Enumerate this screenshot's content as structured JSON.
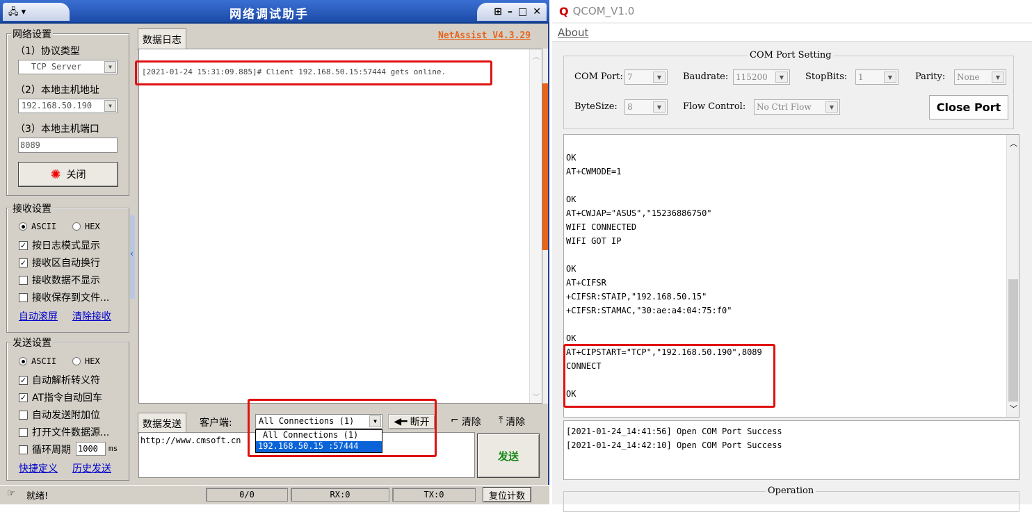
{
  "netassist": {
    "title": "网络调试助手",
    "brand": "NetAssist V4.3.29",
    "network": {
      "group_title": "网络设置",
      "protocol_label": "（1）协议类型",
      "protocol_value": "TCP Server",
      "host_label": "（2）本地主机地址",
      "host_value": "192.168.50.190",
      "port_label": "（3）本地主机端口",
      "port_value": "8089",
      "close_label": "关闭"
    },
    "recv": {
      "group_title": "接收设置",
      "ascii": "ASCII",
      "hex": "HEX",
      "checks": [
        "按日志模式显示",
        "接收区自动换行",
        "接收数据不显示",
        "接收保存到文件..."
      ],
      "link_autoscroll": "自动滚屏",
      "link_clear": "清除接收"
    },
    "send": {
      "group_title": "发送设置",
      "ascii": "ASCII",
      "hex": "HEX",
      "checks": [
        "自动解析转义符",
        "AT指令自动回车",
        "自动发送附加位",
        "打开文件数据源...",
        "循环周期"
      ],
      "cycle_value": "1000",
      "cycle_unit": "ms",
      "link_shortcut": "快捷定义",
      "link_history": "历史发送"
    },
    "log_tab": "数据日志",
    "log_line": "[2021-01-24 15:31:09.885]# Client 192.168.50.15:57444 gets online.",
    "send_tab": "数据发送",
    "client_label": "客户端:",
    "client_select": "All Connections (1)",
    "client_options": [
      "All Connections (1)",
      "192.168.50.15 :57444"
    ],
    "disconnect": "断开",
    "clear1": "清除",
    "clear2": "清除",
    "send_text": "http://www.cmsoft.cn",
    "send_button": "发送",
    "status": {
      "ready": "就绪!",
      "count": "0/0",
      "rx": "RX:0",
      "tx": "TX:0",
      "reset": "复位计数"
    }
  },
  "qcom": {
    "title": "QCOM_V1.0",
    "menu_about": "About",
    "settings_title": "COM Port Setting",
    "com_port_label": "COM Port:",
    "com_port": "7",
    "baud_label": "Baudrate:",
    "baud": "115200",
    "stopbits_label": "StopBits:",
    "stopbits": "1",
    "parity_label": "Parity:",
    "parity": "None",
    "bytesize_label": "ByteSize:",
    "bytesize": "8",
    "flow_label": "Flow Control:",
    "flow": "No Ctrl Flow",
    "close_port": "Close Port",
    "recv_lines": [
      "OK",
      "AT+CWMODE=1",
      "",
      "OK",
      "AT+CWJAP=\"ASUS\",\"15236886750\"",
      "WIFI CONNECTED",
      "WIFI GOT IP",
      "",
      "OK",
      "AT+CIFSR",
      "+CIFSR:STAIP,\"192.168.50.15\"",
      "+CIFSR:STAMAC,\"30:ae:a4:04:75:f0\"",
      "",
      "OK",
      "AT+CIPSTART=\"TCP\",\"192.168.50.190\",8089",
      "CONNECT",
      "",
      "OK"
    ],
    "log_lines": [
      "[2021-01-24_14:41:56] Open COM Port Success",
      "[2021-01-24_14:42:10] Open COM Port Success"
    ],
    "operation_title": "Operation"
  },
  "colors": {
    "title_blue": "#1c4ba8",
    "brand_orange": "#e8641a",
    "highlight": "#e01010",
    "selection": "#0a64d8",
    "send_green": "#1a8a1a"
  }
}
